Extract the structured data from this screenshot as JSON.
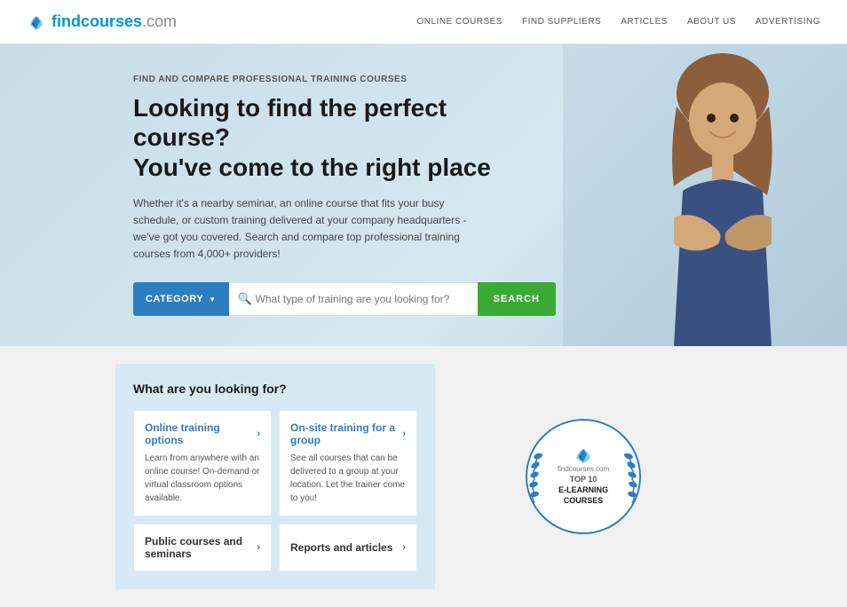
{
  "header": {
    "logo_text": "findcourses",
    "logo_domain": ".com",
    "nav_items": [
      {
        "label": "ONLINE COURSES",
        "id": "online-courses"
      },
      {
        "label": "FIND SUPPLIERS",
        "id": "find-suppliers"
      },
      {
        "label": "ARTICLES",
        "id": "articles"
      },
      {
        "label": "ABOUT US",
        "id": "about-us"
      },
      {
        "label": "ADVERTISING",
        "id": "advertising"
      }
    ]
  },
  "hero": {
    "subtitle": "FIND AND COMPARE PROFESSIONAL TRAINING COURSES",
    "title_line1": "Looking to find the perfect course?",
    "title_line2": "You've come to the right place",
    "description": "Whether it's a nearby seminar, an online course that fits your busy schedule, or custom training delivered at your company headquarters - we've got you covered. Search and compare top professional training courses from 4,000+ providers!",
    "category_label": "CATEGORY",
    "search_placeholder": "What type of training are you looking for?",
    "search_button_label": "SEARCH"
  },
  "bottom": {
    "section_title": "What are you looking for?",
    "cards": [
      {
        "id": "online-training",
        "title": "Online training options",
        "description": "Learn from anywhere with an online course! On-demand or virtual classroom options available.",
        "has_arrow": true
      },
      {
        "id": "onsite-training",
        "title": "On-site training for a group",
        "description": "See all courses that can be delivered to a group at your location. Let the trainer come to you!",
        "has_arrow": true
      },
      {
        "id": "public-courses",
        "title": "Public courses and seminars",
        "has_arrow": true
      },
      {
        "id": "reports-articles",
        "title": "Reports and articles",
        "has_arrow": true
      }
    ],
    "badge": {
      "site_label": "findcourses.com",
      "top_text": "TOP 10",
      "number": "10",
      "main_text": "E-LEARNING\nCOURSES"
    }
  },
  "colors": {
    "blue": "#2d7dc3",
    "green": "#3aaa35",
    "light_blue_bg": "#d6eaf5",
    "hero_bg": "#c8dce8"
  }
}
